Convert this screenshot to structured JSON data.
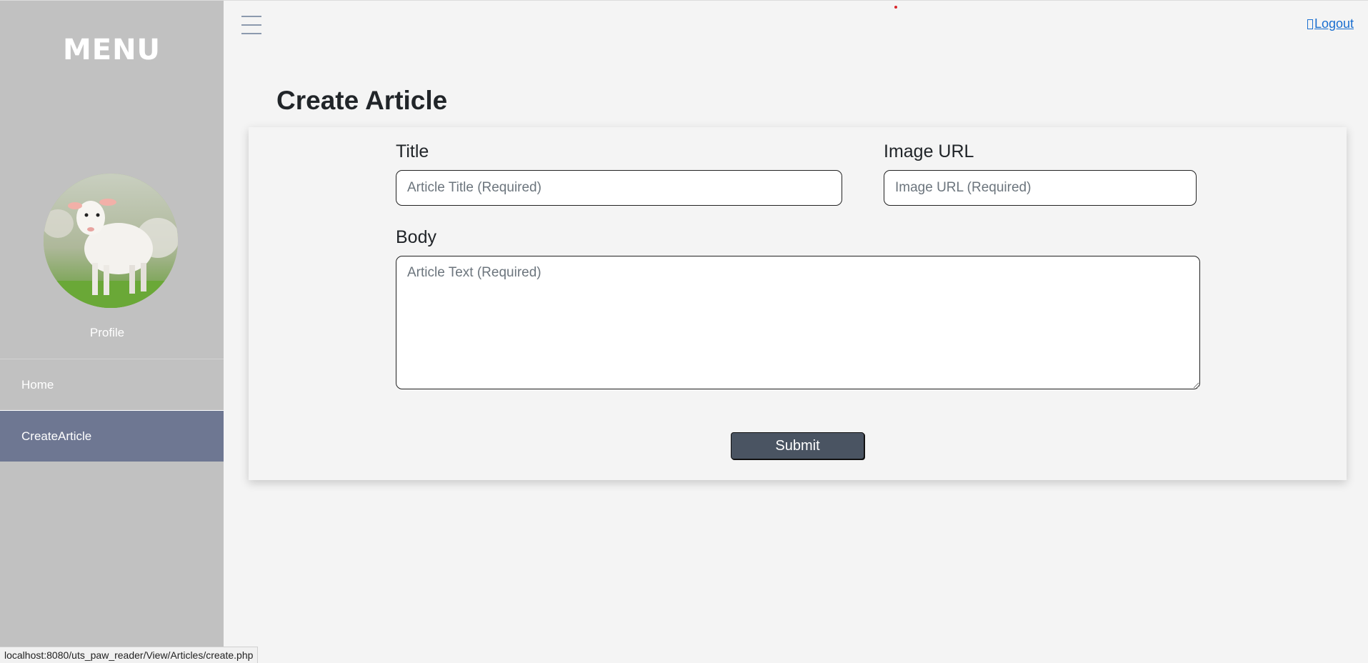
{
  "sidebar": {
    "title": "MENU",
    "profile_label": "Profile",
    "items": [
      {
        "label": "Home",
        "active": false
      },
      {
        "label": "CreateArticle",
        "active": true
      }
    ]
  },
  "header": {
    "logout_label": "Logout"
  },
  "page": {
    "title": "Create Article"
  },
  "form": {
    "title_label": "Title",
    "title_placeholder": "Article Title (Required)",
    "image_label": "Image URL",
    "image_placeholder": "Image URL (Required)",
    "body_label": "Body",
    "body_placeholder": "Article Text (Required)",
    "submit_label": "Submit"
  },
  "status_bar": {
    "url": "localhost:8080/uts_paw_reader/View/Articles/create.php"
  },
  "colors": {
    "sidebar_bg": "#c1c1c1",
    "active_item_bg": "#6e7792",
    "page_bg": "#f4f4f4",
    "button_bg": "#4a5462",
    "link": "#1a6fd0"
  }
}
